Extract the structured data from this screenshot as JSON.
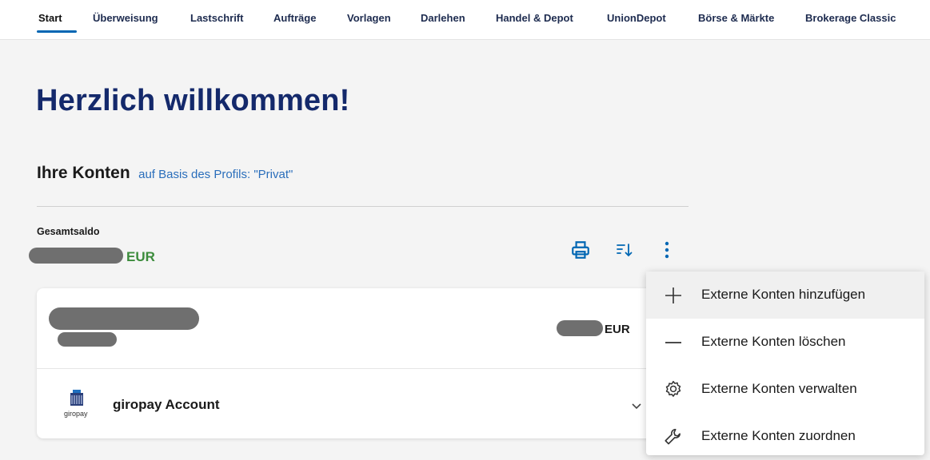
{
  "nav": {
    "tabs": [
      "Start",
      "Überweisung",
      "Lastschrift",
      "Aufträge",
      "Vorlagen",
      "Darlehen",
      "Handel & Depot",
      "UnionDepot",
      "Börse & Märkte",
      "Brokerage Classic"
    ],
    "active": "Start"
  },
  "welcome": "Herzlich willkommen!",
  "konten": {
    "title": "Ihre Konten",
    "profile_note": "auf Basis des Profils: \"Privat\""
  },
  "saldo": {
    "label": "Gesamtsaldo",
    "currency": "EUR"
  },
  "toolbar": {
    "print_icon": "print-icon",
    "sort_icon": "sort-icon",
    "more_icon": "more-vertical-icon"
  },
  "account": {
    "currency": "EUR",
    "giropay_logo_text": "giropay",
    "giropay_name": "giropay Account"
  },
  "menu": {
    "items": [
      {
        "label": "Externe Konten hinzufügen",
        "icon": "plus-icon"
      },
      {
        "label": "Externe Konten löschen",
        "icon": "minus-icon"
      },
      {
        "label": "Externe Konten verwalten",
        "icon": "gear-icon"
      },
      {
        "label": "Externe Konten zuordnen",
        "icon": "wrench-icon"
      }
    ]
  },
  "colors": {
    "brand_navy": "#14296b",
    "accent_blue": "#0066b3",
    "link_blue": "#2a6ebb",
    "saldo_green": "#3c8c3c"
  }
}
